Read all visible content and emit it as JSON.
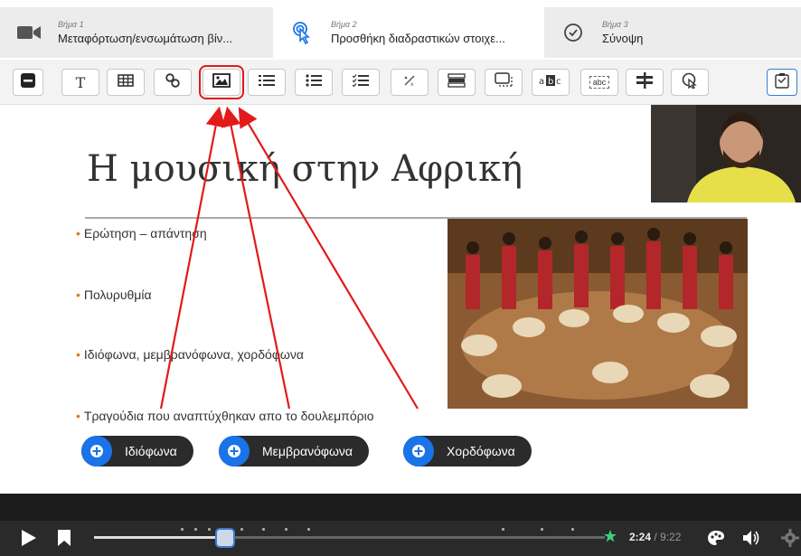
{
  "steps": [
    {
      "sub": "Βήμα 1",
      "title": "Μεταφόρτωση/ενσωμάτωση βίν...",
      "icon": "video-camera-icon"
    },
    {
      "sub": "Βήμα 2",
      "title": "Προσθήκη διαδραστικών στοιχε...",
      "icon": "touch-pointer-icon"
    },
    {
      "sub": "Βήμα 3",
      "title": "Σύνοψη",
      "icon": "check-circle-icon"
    }
  ],
  "toolbar": {
    "items": [
      "label-icon",
      "text-icon",
      "table-icon",
      "link-icon",
      "image-icon",
      "list-icon",
      "numbered-list-icon",
      "checklist-icon",
      "fraction-icon",
      "drag-drop-icon",
      "single-choice-icon",
      "fill-blanks-icon",
      "mark-words-icon",
      "crossroads-icon",
      "hotspot-icon",
      "summary-icon"
    ],
    "text_label": "T",
    "mark_words_label": "abc"
  },
  "slide": {
    "title": "Η μουσική στην Αφρική",
    "bullets": [
      "Ερώτηση – απάντηση",
      "Πολυρυθμία",
      "Ιδιόφωνα, μεμβρανόφωνα, χορδόφωνα",
      "Τραγούδια που αναπτύχθηκαν απο το δουλεμπόριο"
    ]
  },
  "hotspots": [
    "Ιδιόφωνα",
    "Μεμβρανόφωνα",
    "Χορδόφωνα"
  ],
  "player": {
    "current_time": "2:24",
    "separator": " / ",
    "total_time": "9:22",
    "progress": 0.256
  },
  "colors": {
    "accent_blue": "#1a73e8",
    "highlight_red": "#e21a1a",
    "bullet_orange": "#e07b1c"
  }
}
